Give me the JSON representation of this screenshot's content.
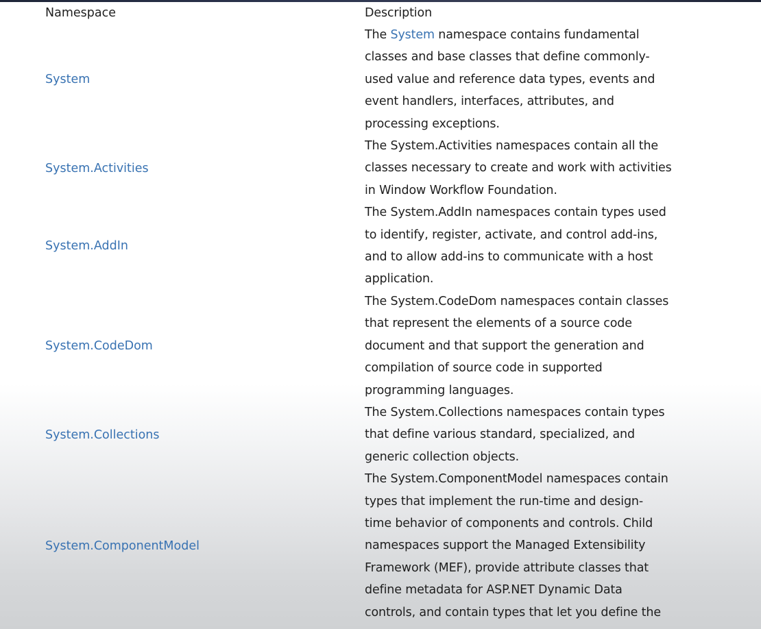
{
  "table": {
    "headers": {
      "namespace": "Namespace",
      "description": "Description"
    },
    "rows": [
      {
        "name": "System",
        "desc_prefix": "The ",
        "desc_link": "System",
        "desc_line1_rest": " namespace contains fundamental",
        "lines": [
          "classes and base classes that define commonly-",
          "used value and reference data types, events and",
          "event handlers, interfaces, attributes, and",
          "processing exceptions."
        ]
      },
      {
        "name": "System.Activities",
        "lines": [
          "The System.Activities namespaces contain all the",
          "classes necessary to create and work with activities",
          "in Window Workflow Foundation."
        ]
      },
      {
        "name": "System.AddIn",
        "lines": [
          "The System.AddIn namespaces contain types used",
          "to identify, register, activate, and control add-ins,",
          "and to allow add-ins to communicate with a host",
          "application."
        ]
      },
      {
        "name": "System.CodeDom",
        "lines": [
          "The System.CodeDom namespaces contain classes",
          "that represent the elements of a source code",
          "document and that support the generation and",
          "compilation of source code in supported",
          "programming languages."
        ]
      },
      {
        "name": "System.Collections",
        "lines": [
          "The System.Collections namespaces contain types",
          "that define various standard, specialized, and",
          "generic collection objects."
        ]
      },
      {
        "name": "System.ComponentModel",
        "lines": [
          "The System.ComponentModel namespaces contain",
          "types that implement the run-time and design-",
          "time behavior of components and controls. Child",
          "namespaces support the Managed Extensibility",
          "Framework (MEF), provide attribute classes that",
          "define metadata for ASP.NET Dynamic Data",
          "controls, and contain types that let you define the"
        ]
      }
    ]
  },
  "colors": {
    "link": "#3872b2",
    "text": "#1e1e1e"
  }
}
